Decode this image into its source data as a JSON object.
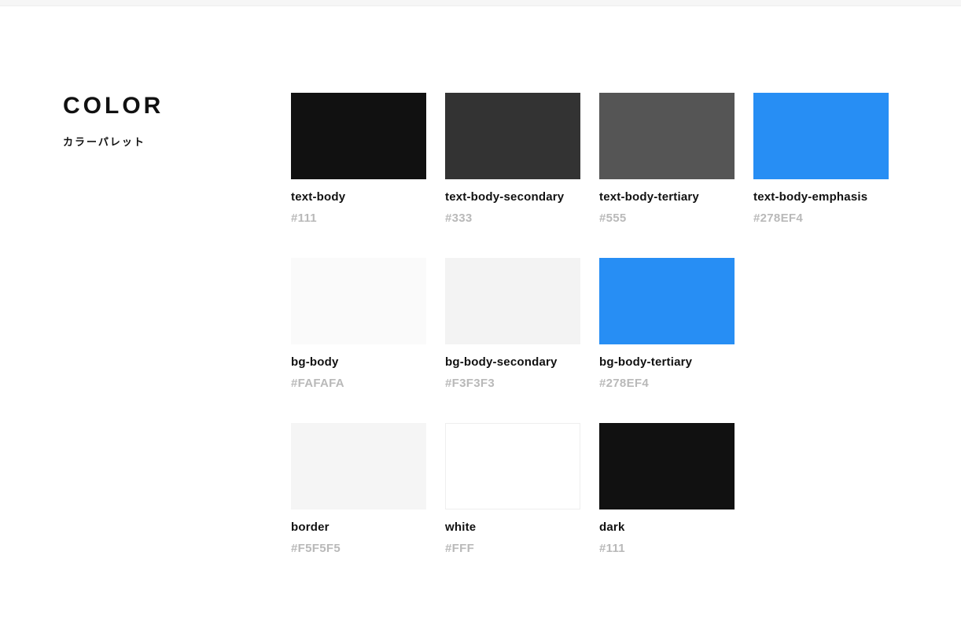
{
  "header": {
    "title": "COLOR",
    "subtitle": "カラーパレット"
  },
  "swatches": [
    {
      "name": "text-body",
      "hex": "#111",
      "color": "#111111"
    },
    {
      "name": "text-body-secondary",
      "hex": "#333",
      "color": "#333333"
    },
    {
      "name": "text-body-tertiary",
      "hex": "#555",
      "color": "#555555"
    },
    {
      "name": "text-body-emphasis",
      "hex": "#278EF4",
      "color": "#278EF4"
    },
    {
      "name": "bg-body",
      "hex": "#FAFAFA",
      "color": "#FAFAFA"
    },
    {
      "name": "bg-body-secondary",
      "hex": "#F3F3F3",
      "color": "#F3F3F3"
    },
    {
      "name": "bg-body-tertiary",
      "hex": "#278EF4",
      "color": "#278EF4"
    },
    {
      "name": "border",
      "hex": "#F5F5F5",
      "color": "#F5F5F5"
    },
    {
      "name": "white",
      "hex": "#FFF",
      "color": "#FFFFFF"
    },
    {
      "name": "dark",
      "hex": "#111",
      "color": "#111111"
    }
  ]
}
